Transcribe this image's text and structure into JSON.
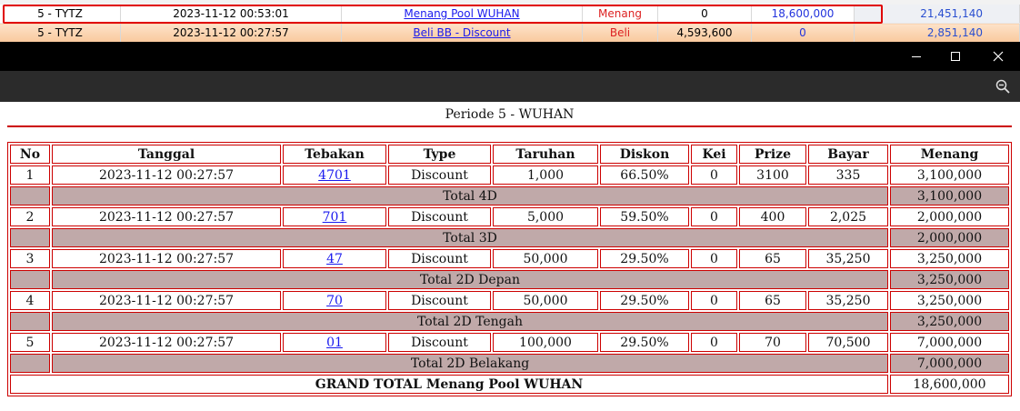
{
  "summary_rows": [
    {
      "periode": "5 - TYTZ",
      "tanggal": "2023-11-12 00:53:01",
      "keterangan": "Menang Pool WUHAN",
      "jenis": "Menang",
      "debit": "0",
      "kredit": "18,600,000",
      "saldo": "21,451,140"
    },
    {
      "periode": "5 - TYTZ",
      "tanggal": "2023-11-12 00:27:57",
      "keterangan": "Beli BB - Discount",
      "jenis": "Beli",
      "debit": "4,593,600",
      "kredit": "0",
      "saldo": "2,851,140"
    }
  ],
  "colors": {
    "accent": "#cc0000",
    "link": "#1a1aee",
    "total_row": "#c0a9a9",
    "highlight_row2": "#f9c99d"
  },
  "icons": {
    "minimize": "minimize-icon",
    "maximize": "maximize-icon",
    "close": "close-icon",
    "zoom": "zoom-out-icon"
  },
  "periode_title": "Periode 5 - WUHAN",
  "headers": [
    "No",
    "Tanggal",
    "Tebakan",
    "Type",
    "Taruhan",
    "Diskon",
    "Kei",
    "Prize",
    "Bayar",
    "Menang"
  ],
  "bets": [
    {
      "no": "1",
      "tanggal": "2023-11-12 00:27:57",
      "tebakan": "4701",
      "type": "Discount",
      "taruhan": "1,000",
      "diskon": "66.50%",
      "kei": "0",
      "prize": "3100",
      "bayar": "335",
      "menang": "3,100,000",
      "total_label": "Total 4D",
      "total_value": "3,100,000"
    },
    {
      "no": "2",
      "tanggal": "2023-11-12 00:27:57",
      "tebakan": "701",
      "type": "Discount",
      "taruhan": "5,000",
      "diskon": "59.50%",
      "kei": "0",
      "prize": "400",
      "bayar": "2,025",
      "menang": "2,000,000",
      "total_label": "Total 3D",
      "total_value": "2,000,000"
    },
    {
      "no": "3",
      "tanggal": "2023-11-12 00:27:57",
      "tebakan": "47",
      "type": "Discount",
      "taruhan": "50,000",
      "diskon": "29.50%",
      "kei": "0",
      "prize": "65",
      "bayar": "35,250",
      "menang": "3,250,000",
      "total_label": "Total 2D Depan",
      "total_value": "3,250,000"
    },
    {
      "no": "4",
      "tanggal": "2023-11-12 00:27:57",
      "tebakan": "70",
      "type": "Discount",
      "taruhan": "50,000",
      "diskon": "29.50%",
      "kei": "0",
      "prize": "65",
      "bayar": "35,250",
      "menang": "3,250,000",
      "total_label": "Total 2D Tengah",
      "total_value": "3,250,000"
    },
    {
      "no": "5",
      "tanggal": "2023-11-12 00:27:57",
      "tebakan": "01",
      "type": "Discount",
      "taruhan": "100,000",
      "diskon": "29.50%",
      "kei": "0",
      "prize": "70",
      "bayar": "70,500",
      "menang": "7,000,000",
      "total_label": "Total 2D Belakang",
      "total_value": "7,000,000"
    }
  ],
  "grand_total": {
    "label": "GRAND TOTAL  Menang Pool WUHAN",
    "value": "18,600,000"
  }
}
